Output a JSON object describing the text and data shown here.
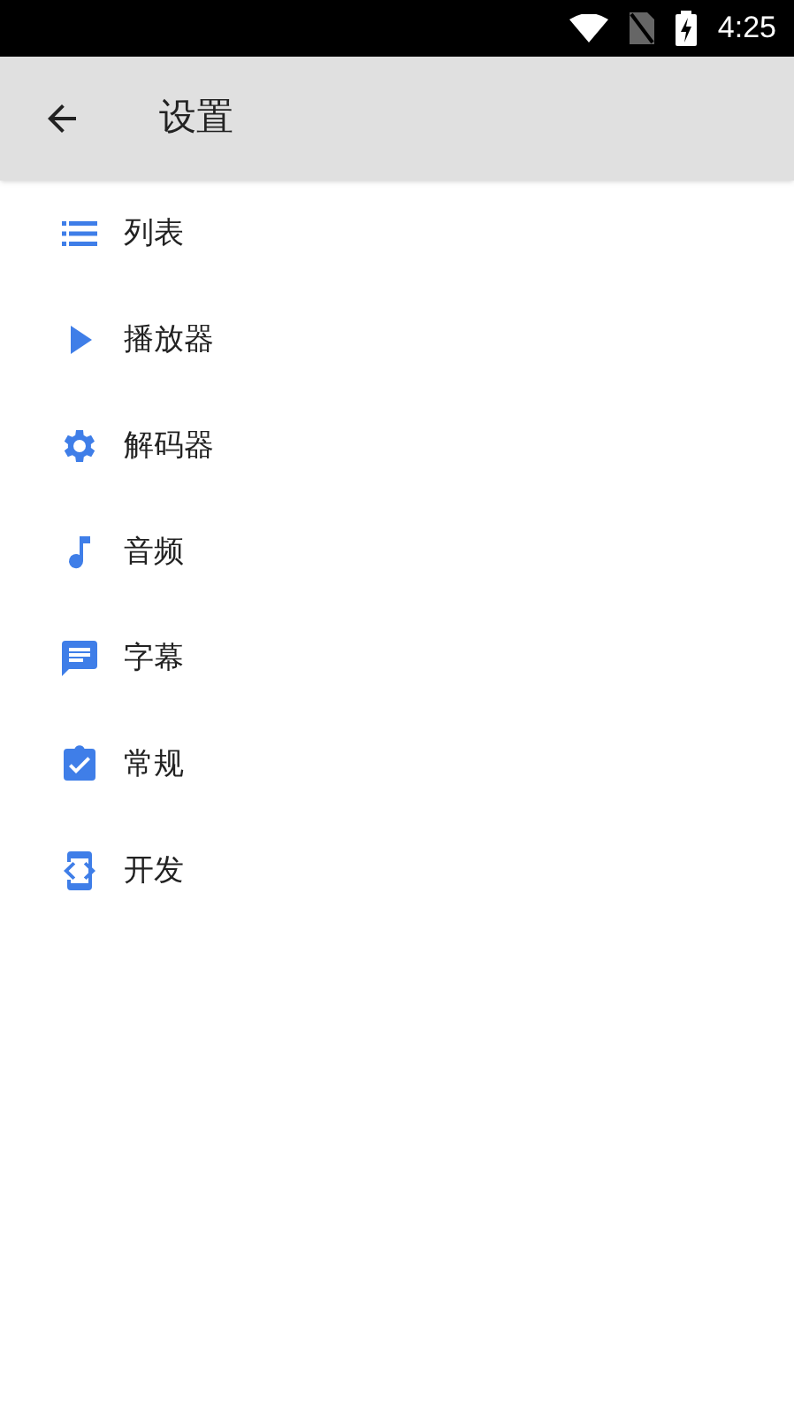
{
  "status_bar": {
    "time": "4:25"
  },
  "app_bar": {
    "title": "设置"
  },
  "items": [
    {
      "kind": "list",
      "label": "列表"
    },
    {
      "kind": "play",
      "label": "播放器"
    },
    {
      "kind": "gear",
      "label": "解码器"
    },
    {
      "kind": "music",
      "label": "音频"
    },
    {
      "kind": "chat",
      "label": "字幕"
    },
    {
      "kind": "clipboard",
      "label": "常规"
    },
    {
      "kind": "code",
      "label": "开发"
    }
  ]
}
